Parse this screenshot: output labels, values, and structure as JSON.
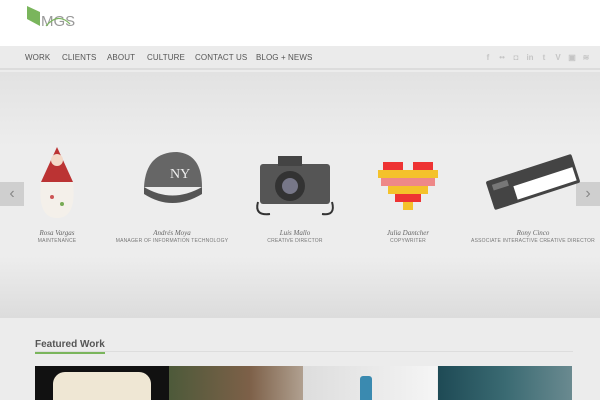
{
  "brand": {
    "name": "MGS",
    "accent": "#7ab55c"
  },
  "nav": {
    "items": [
      "WORK",
      "CLIENTS",
      "ABOUT",
      "CULTURE",
      "CONTACT US",
      "BLOG + NEWS"
    ]
  },
  "social": [
    "facebook-icon",
    "flickr-icon",
    "instagram-icon",
    "linkedin-icon",
    "twitter-icon",
    "vimeo-icon",
    "youtube-icon",
    "rss-icon"
  ],
  "team": [
    {
      "name": "Rosa Vargas",
      "role": "MAINTENANCE"
    },
    {
      "name": "Andrés Moya",
      "role": "MANAGER OF INFORMATION TECHNOLOGY"
    },
    {
      "name": "Luis Mallo",
      "role": "CREATIVE DIRECTOR"
    },
    {
      "name": "Julia Dantcher",
      "role": "COPYWRITER"
    },
    {
      "name": "Rony Cinco",
      "role": "ASSOCIATE INTERACTIVE CREATIVE DIRECTOR"
    }
  ],
  "featured": {
    "title": "Featured Work"
  },
  "slider": {
    "prev": "‹",
    "next": "›"
  }
}
